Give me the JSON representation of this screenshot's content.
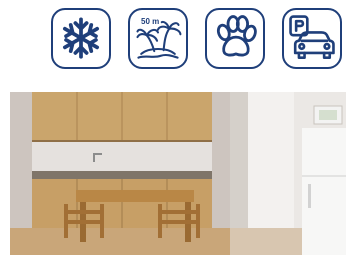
{
  "amenities": [
    {
      "name": "snowflake-icon",
      "label": ""
    },
    {
      "name": "beach-island-icon",
      "label": "50 m"
    },
    {
      "name": "paw-icon",
      "label": ""
    },
    {
      "name": "parking-car-icon",
      "label": "P"
    }
  ],
  "photo": {
    "subject": "apartment-kitchen-dining-room"
  },
  "colors": {
    "icon_stroke": "#1f3f7a",
    "icon_bg": "#ffffff"
  }
}
